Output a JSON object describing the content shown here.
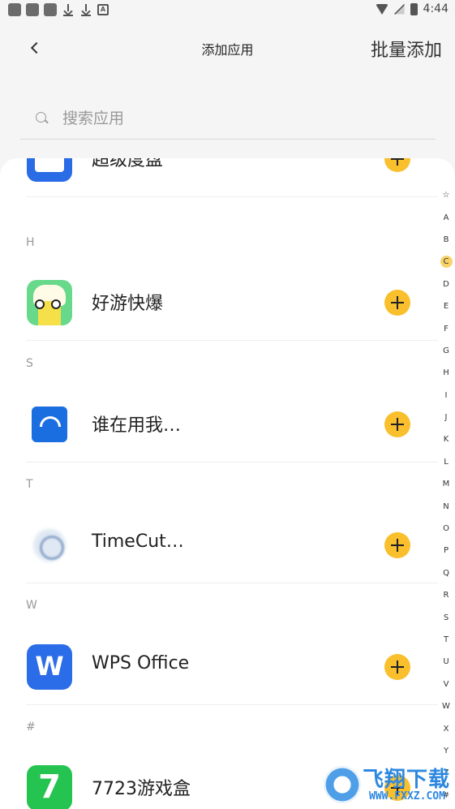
{
  "status_bar": {
    "time": "4:44"
  },
  "header": {
    "title": "添加应用",
    "batch_label": "批量添加"
  },
  "search": {
    "placeholder": "搜索应用",
    "value": ""
  },
  "sections": [
    "H",
    "S",
    "T",
    "W",
    "#"
  ],
  "apps": [
    {
      "name": "超级度盘",
      "icon": "baidu-disk-icon"
    },
    {
      "name": "好游快爆",
      "icon": "haoyou-icon"
    },
    {
      "name": "谁在用我…",
      "icon": "wifi-shield-icon"
    },
    {
      "name": "TimeCut…",
      "icon": "timecut-icon"
    },
    {
      "name": "WPS Office",
      "icon": "wps-icon"
    },
    {
      "name": "7723游戏盒",
      "icon": "7723-icon"
    }
  ],
  "index": {
    "letters": [
      "☆",
      "A",
      "B",
      "C",
      "D",
      "E",
      "F",
      "G",
      "H",
      "I",
      "J",
      "K",
      "L",
      "M",
      "N",
      "O",
      "P",
      "Q",
      "R",
      "S",
      "T",
      "U",
      "V",
      "W",
      "X",
      "Y",
      "Z",
      "#"
    ],
    "active": "C"
  },
  "watermark": {
    "text": "飞翔下载",
    "url": "WWW.FXXZ.COM"
  },
  "colors": {
    "accent": "#f9bf2c",
    "background": "#f5f5f5"
  }
}
